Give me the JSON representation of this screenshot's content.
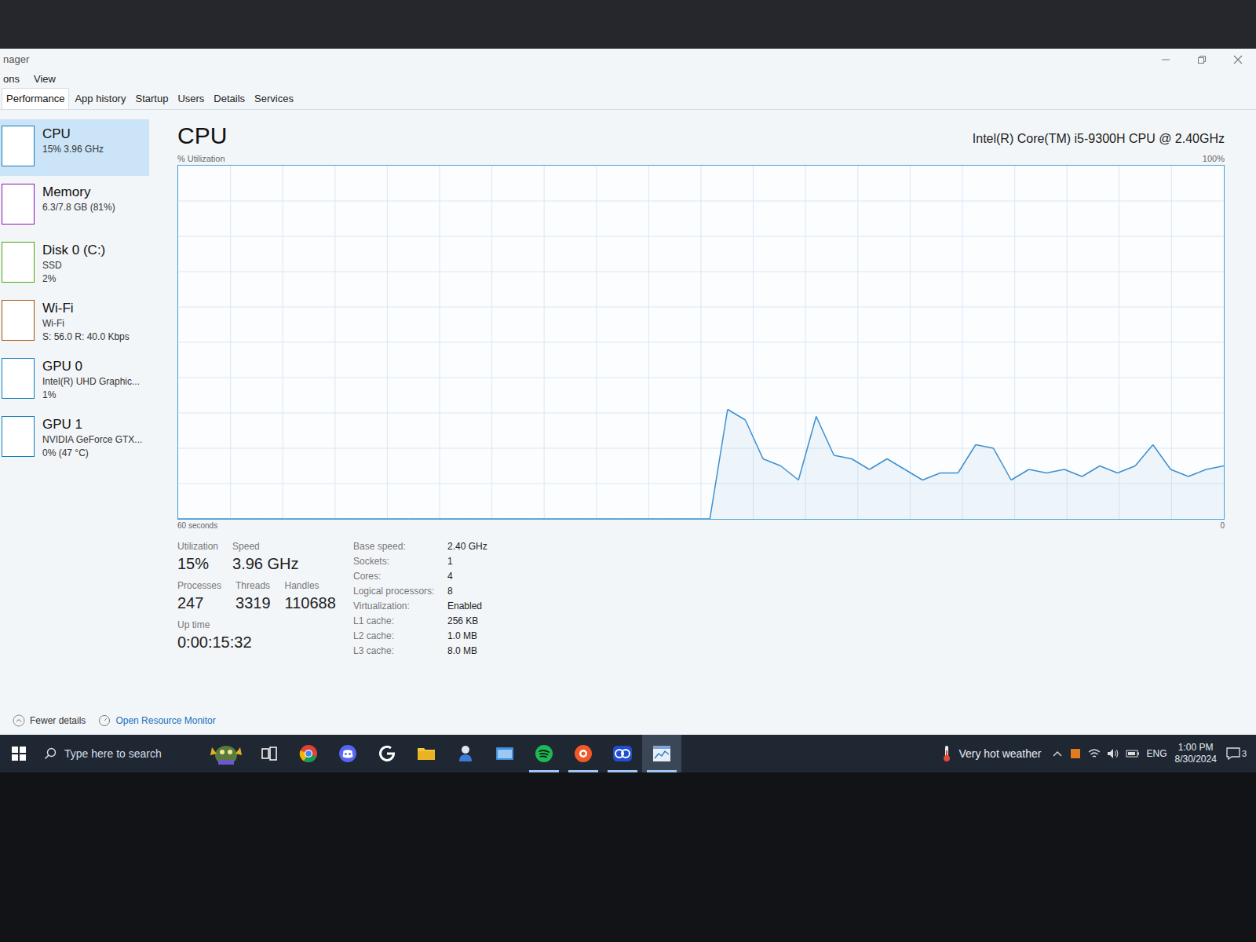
{
  "window": {
    "title": "nager",
    "menu": [
      "ons",
      "View"
    ]
  },
  "tabs": [
    {
      "label": "Performance",
      "selected": true
    },
    {
      "label": "App history",
      "selected": false
    },
    {
      "label": "Startup",
      "selected": false
    },
    {
      "label": "Users",
      "selected": false
    },
    {
      "label": "Details",
      "selected": false
    },
    {
      "label": "Services",
      "selected": false
    }
  ],
  "sidebar": {
    "items": [
      {
        "name": "CPU",
        "lines": [
          "15% 3.96 GHz"
        ],
        "selected": true,
        "color": "#117dbb"
      },
      {
        "name": "Memory",
        "lines": [
          "6.3/7.8 GB (81%)"
        ],
        "selected": false,
        "color": "#8b12ae"
      },
      {
        "name": "Disk 0 (C:)",
        "lines": [
          "SSD",
          "2%"
        ],
        "selected": false,
        "color": "#4da60c"
      },
      {
        "name": "Wi-Fi",
        "lines": [
          "Wi-Fi",
          "S: 56.0 R: 40.0 Kbps"
        ],
        "selected": false,
        "color": "#a74f01"
      },
      {
        "name": "GPU 0",
        "lines": [
          "Intel(R) UHD Graphic...",
          "1%"
        ],
        "selected": false,
        "color": "#117dbb"
      },
      {
        "name": "GPU 1",
        "lines": [
          "NVIDIA GeForce GTX...",
          "0% (47 °C)"
        ],
        "selected": false,
        "color": "#117dbb"
      }
    ]
  },
  "cpu": {
    "title": "CPU",
    "model": "Intel(R) Core(TM) i5-9300H CPU @ 2.40GHz",
    "axis_label": "% Utilization",
    "y_max": "100%",
    "x_label": "60 seconds",
    "y_min": "0",
    "series": [
      {
        "values": [
          0,
          0,
          0,
          0,
          0,
          0,
          0,
          0,
          0,
          0,
          0,
          0,
          0,
          0,
          0,
          0,
          0,
          0,
          0,
          0,
          0,
          0,
          0,
          0,
          0,
          0,
          0,
          0,
          0,
          0,
          0,
          31,
          28,
          17,
          15,
          11,
          29,
          18,
          17,
          14,
          17,
          14,
          11,
          13,
          13,
          21,
          20,
          11,
          14,
          13,
          14,
          12,
          15,
          13,
          15,
          21,
          14,
          12,
          14,
          15
        ]
      }
    ]
  },
  "stats": {
    "rows": [
      [
        {
          "label": "Utilization",
          "value": "15%"
        },
        {
          "label": "Speed",
          "value": "3.96 GHz"
        }
      ],
      [
        {
          "label": "Processes",
          "value": "247"
        },
        {
          "label": "Threads",
          "value": "3319"
        },
        {
          "label": "Handles",
          "value": "110688"
        }
      ],
      [
        {
          "label": "Up time",
          "value": "0:00:15:32"
        }
      ]
    ],
    "details": [
      {
        "label": "Base speed:",
        "value": "2.40 GHz"
      },
      {
        "label": "Sockets:",
        "value": "1"
      },
      {
        "label": "Cores:",
        "value": "4"
      },
      {
        "label": "Logical processors:",
        "value": "8"
      },
      {
        "label": "Virtualization:",
        "value": "Enabled"
      },
      {
        "label": "L1 cache:",
        "value": "256 KB"
      },
      {
        "label": "L2 cache:",
        "value": "1.0 MB"
      },
      {
        "label": "L3 cache:",
        "value": "8.0 MB"
      }
    ]
  },
  "footer": {
    "fewer_details": "Fewer details",
    "resource_monitor": "Open Resource Monitor"
  },
  "taskbar": {
    "search": "Type here to search",
    "apps": [
      {
        "running": false,
        "selected": false
      },
      {
        "running": false,
        "selected": false
      },
      {
        "running": false,
        "selected": false
      },
      {
        "running": false,
        "selected": false
      },
      {
        "running": false,
        "selected": false
      },
      {
        "running": false,
        "selected": false
      },
      {
        "running": false,
        "selected": false
      },
      {
        "running": true,
        "selected": false
      },
      {
        "running": true,
        "selected": false
      },
      {
        "running": true,
        "selected": false
      },
      {
        "running": true,
        "selected": true
      }
    ],
    "weather": "Very hot weather",
    "language": "ENG",
    "time": "1:00 PM",
    "date": "8/30/2024",
    "notifications": "3"
  }
}
